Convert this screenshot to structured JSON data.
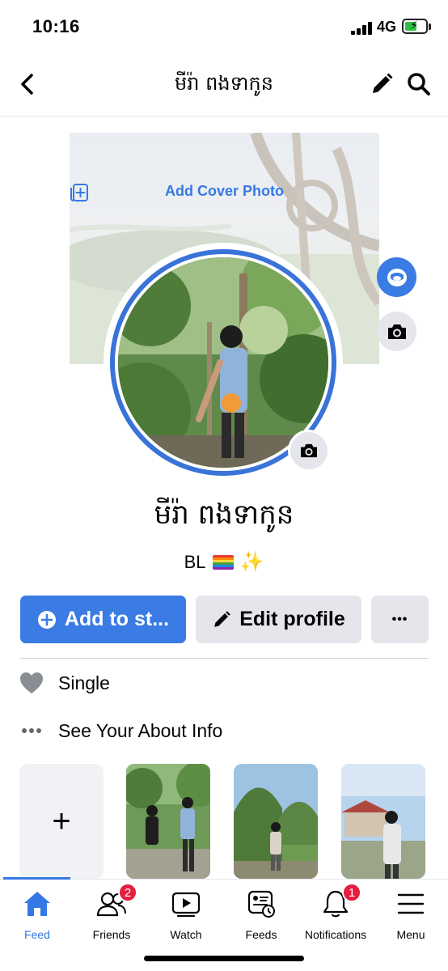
{
  "status": {
    "time": "10:16",
    "network": "4G"
  },
  "header": {
    "title": "មីរ៉ា ពងទាកូន",
    "back_icon": "chevron-left-icon",
    "edit_icon": "pencil-icon",
    "search_icon": "search-icon"
  },
  "cover": {
    "add_label": "Add Cover Photo"
  },
  "profile": {
    "name": "មីរ៉ា ពងទាកូន",
    "bio_text": "BL"
  },
  "actions": {
    "add_story": "Add to st...",
    "edit_profile": "Edit profile",
    "more": "•••"
  },
  "info": [
    {
      "icon": "heart-icon",
      "label": "Single"
    },
    {
      "icon": "more-dots-icon",
      "label": "See Your About Info"
    }
  ],
  "stories": {
    "add_symbol": "+"
  },
  "tabs": [
    {
      "label": "Feed",
      "icon": "home-icon",
      "active": true
    },
    {
      "label": "Friends",
      "icon": "friends-icon",
      "badge": "2"
    },
    {
      "label": "Watch",
      "icon": "watch-icon"
    },
    {
      "label": "Feeds",
      "icon": "feeds-icon"
    },
    {
      "label": "Notifications",
      "icon": "bell-icon",
      "badge": "1"
    },
    {
      "label": "Menu",
      "icon": "menu-icon"
    }
  ],
  "colors": {
    "accent": "#3578e5",
    "badge": "#e41e3f",
    "button_gray": "#e4e6eb"
  }
}
